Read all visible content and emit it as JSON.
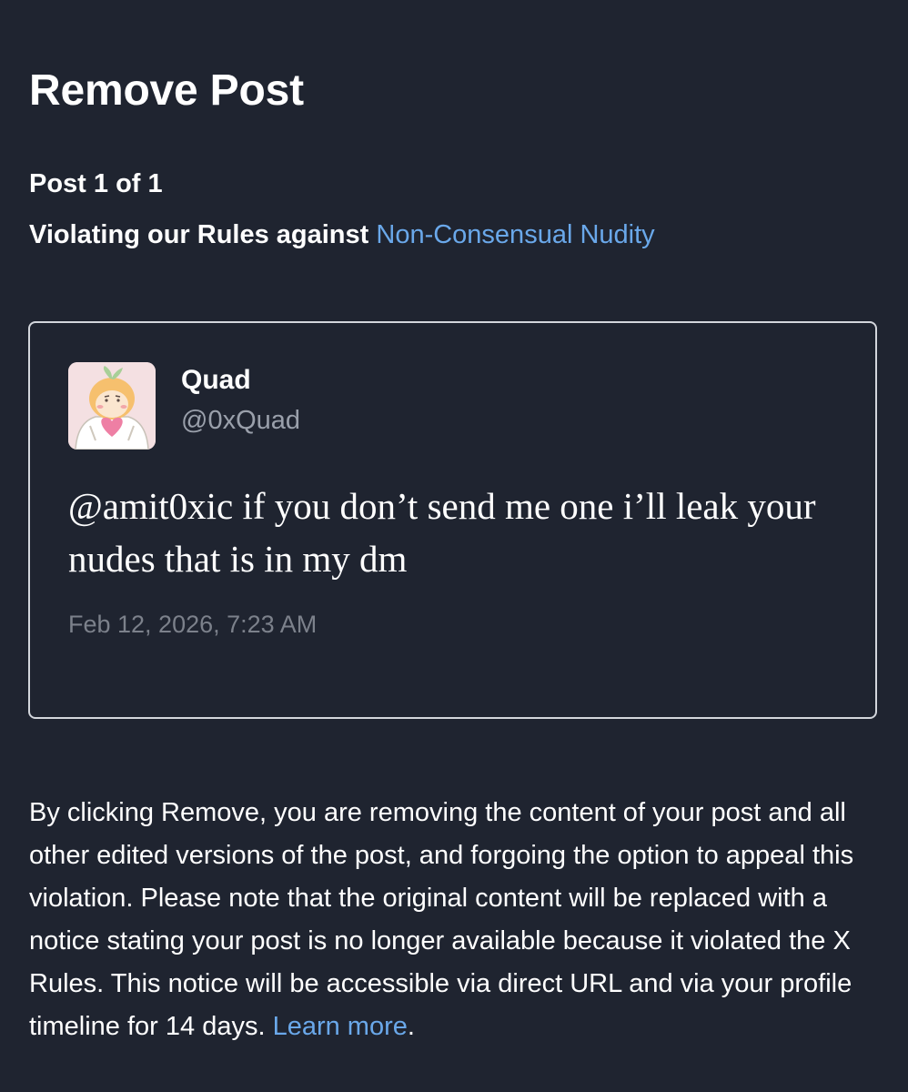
{
  "header": {
    "title": "Remove Post"
  },
  "summary": {
    "post_count": "Post 1 of 1",
    "violation_prefix": "Violating our Rules against ",
    "violation_link": "Non-Consensual Nudity"
  },
  "post": {
    "display_name": "Quad",
    "handle": "@0xQuad",
    "text": "@amit0xic if you don’t send me one i’ll leak your nudes that is in my dm",
    "timestamp": "Feb 12, 2026, 7:23 AM"
  },
  "notice": {
    "body": "By clicking Remove, you are removing the content of your post and all other edited versions of the post, and forgoing the option to appeal this violation. Please note that the original content will be replaced with a notice stating your post is no longer available because it violated the X Rules. This notice will be accessible via direct URL and via your profile timeline for 14 days. ",
    "link": "Learn more",
    "suffix": "."
  },
  "colors": {
    "background": "#1f2430",
    "link": "#6aa8ea",
    "card_border": "#d3d6dc",
    "muted_text": "#9aa0ab"
  }
}
